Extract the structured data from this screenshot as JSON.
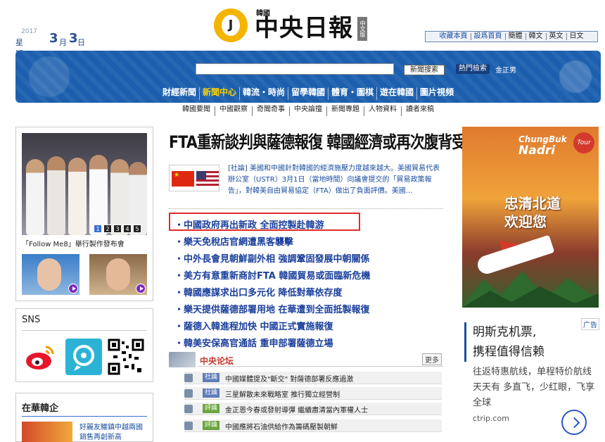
{
  "date": {
    "year": "2017",
    "weekday": "星期五",
    "month": "3",
    "month_unit": "月",
    "day": "3",
    "day_unit": "日"
  },
  "logo": {
    "letter": "J",
    "korea": "韓國",
    "name": "中央日報",
    "edition": "中文版"
  },
  "top_links": [
    "收藏本頁",
    "設爲首頁",
    "簡體",
    "韓文",
    "英文",
    "日文"
  ],
  "search": {
    "placeholder": "",
    "button": "新聞搜索",
    "hot_label": "熱門檢索",
    "hot_item": "金正男"
  },
  "nav": [
    "財經新聞",
    "新聞中心",
    "韓流・時尚",
    "留學韓國",
    "體育・圍棋",
    "遊在韓國",
    "圖片視頻"
  ],
  "subnav": [
    "韓國要聞",
    "中國觀察",
    "奇聞奇事",
    "中央論擅",
    "新聞專題",
    "人物資料",
    "讀者來稿"
  ],
  "photo": {
    "caption": "「Follow Me8」舉行製作發布會",
    "pages": [
      "1",
      "2",
      "3",
      "4",
      "5"
    ]
  },
  "sns": {
    "title": "SNS"
  },
  "zaihua": {
    "title": "在華韓企",
    "item1": "好麗友鱷鎮中越兩國",
    "item2": "銷售再創新高"
  },
  "headline": "FTA重新談判與薩德報復 韓國經濟或再次腹背受敵",
  "feature": {
    "text": "[社論] 美國和中國針對韓國的經濟施壓力度越來越大。美國貿易代表辦公室（USTR）3月1日（當地時間）向議會提交的「貿易政策報告」，對韓美自由貿易協定（FTA）做出了負面評價。美國…"
  },
  "news": [
    "・中國政府再出新政 全面控製赴韓游",
    "・樂天免稅店官網遭黑客襲擊",
    "・中外長會見朝鮮副外相 強調鞏固發展中朝關係",
    "・美方有意重新商討FTA 韓國貿易或面臨新危機",
    "・韓國應謀求出口多元化 降低對華依存度",
    "・樂天提供薩德部署用地 在華遭到全面抵製報復",
    "・薩德入韓進程加快 中國正式實施報復",
    "・韓美安保高官通話 重申部署薩德立場"
  ],
  "forum": {
    "title": "中央论坛",
    "more": "更多",
    "items": [
      {
        "tag": "社論",
        "text": "中國媒體提及\"斷交\" 對薩德部署反應過激"
      },
      {
        "tag": "社論",
        "text": "三星解散未來戰略室 推行獨立經營制"
      },
      {
        "tag": "評論",
        "text": "金正恩今春或發射導彈 繼續肅清當內軍權人士"
      },
      {
        "tag": "評論",
        "text": "中國應將石油供給作為籌碼壓製朝鮮"
      }
    ]
  },
  "ad_top": {
    "brand": "ChungBuk",
    "tour": "Tour",
    "nadri": "Nadri",
    "line1": "忠清北道",
    "line2": "欢迎您"
  },
  "ad2": {
    "tag": "广告",
    "h1": "明斯克机票,",
    "h2": "携程值得信赖",
    "desc": "往返特惠航线，单程特价航线天天有 多直飞，少红眼，飞享全球",
    "source": "ctrip.com"
  }
}
